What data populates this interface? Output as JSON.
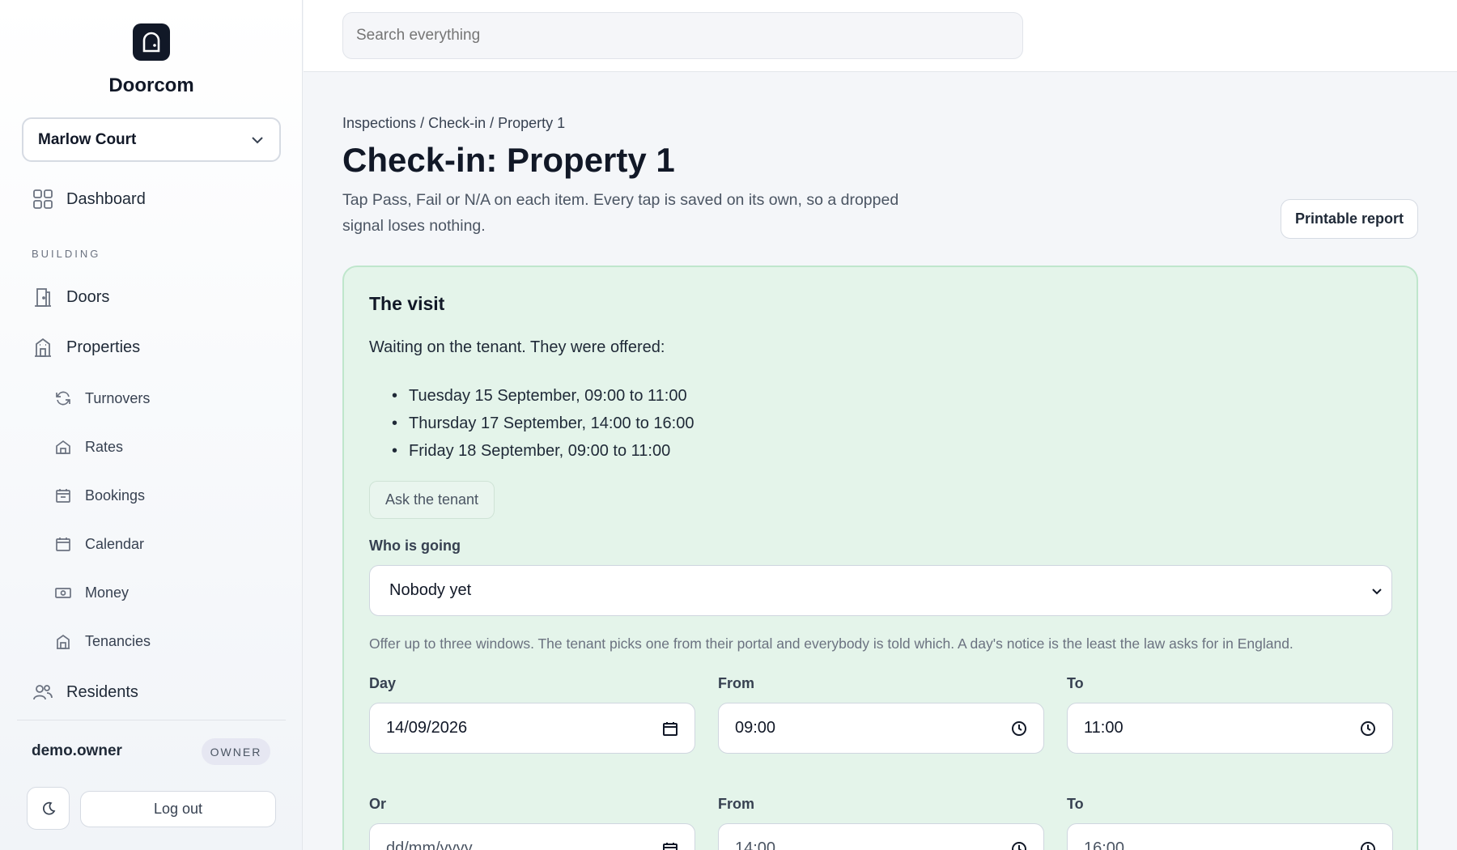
{
  "brand": {
    "name": "Doorcom"
  },
  "property_selector": {
    "value": "Marlow Court"
  },
  "nav": {
    "dashboard": "Dashboard",
    "section_building": "BUILDING",
    "doors": "Doors",
    "properties": "Properties",
    "sub": [
      "Turnovers",
      "Rates",
      "Bookings",
      "Calendar",
      "Money",
      "Tenancies"
    ],
    "residents": "Residents"
  },
  "user": {
    "name": "demo.owner",
    "role": "OWNER"
  },
  "logout_label": "Log out",
  "search": {
    "placeholder": "Search everything"
  },
  "breadcrumb": {
    "items": [
      "Inspections",
      "Check-in",
      "Property 1"
    ],
    "separator": " / "
  },
  "page": {
    "title": "Check-in: Property 1",
    "description": "Tap Pass, Fail or N/A on each item. Every tap is saved on its own, so a dropped signal loses nothing.",
    "print_label": "Printable report"
  },
  "visit": {
    "title": "The visit",
    "waiting": "Waiting on the tenant. They were offered:",
    "offers": [
      "Tuesday 15 September, 09:00 to 11:00",
      "Thursday 17 September, 14:00 to 16:00",
      "Friday 18 September, 09:00 to 11:00"
    ],
    "ask_label": "Ask the tenant",
    "who_label": "Who is going",
    "who_value": "Nobody yet",
    "hint": "Offer up to three windows. The tenant picks one from their portal and everybody is told which. A day's notice is the least the law asks for in England.",
    "row1": {
      "day_label": "Day",
      "day": "14/09/2026",
      "from_label": "From",
      "from": "09:00",
      "to_label": "To",
      "to": "11:00"
    },
    "row2": {
      "day_label": "Or",
      "day": "dd/mm/yyyy",
      "from_label": "From",
      "from": "14:00",
      "to_label": "To",
      "to": "16:00"
    }
  },
  "colors": {
    "accent_card": "#e4f4ea",
    "card_border": "#bfe6cc",
    "logo": "#111827"
  }
}
